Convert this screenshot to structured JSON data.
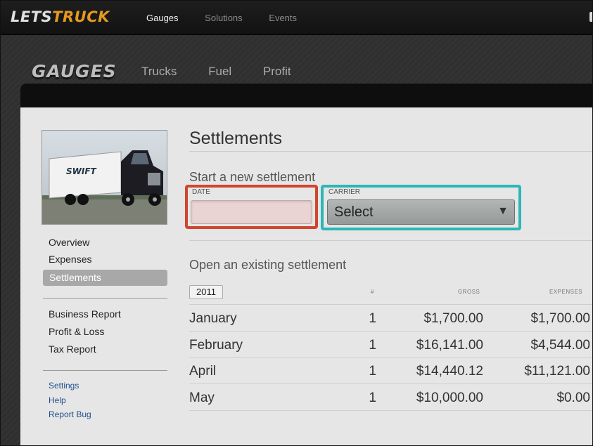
{
  "app": {
    "logo_part1": "LETS",
    "logo_part2": "TRUCK",
    "topnav": [
      "Gauges",
      "Solutions",
      "Events"
    ]
  },
  "section": {
    "title": "GAUGES",
    "subnav": [
      "Trucks",
      "Fuel",
      "Profit"
    ]
  },
  "sidebar": {
    "image_alt": "truck photo",
    "nav1": [
      "Overview",
      "Expenses",
      "Settlements"
    ],
    "active": "Settlements",
    "nav2": [
      "Business Report",
      "Profit & Loss",
      "Tax Report"
    ],
    "links": [
      "Settings",
      "Help",
      "Report Bug"
    ]
  },
  "main": {
    "title": "Settlements",
    "new_heading": "Start a new settlement",
    "date_label": "DATE",
    "date_value": "",
    "carrier_label": "CARRIER",
    "carrier_value": "Select",
    "open_heading": "Open an existing settlement",
    "year": "2011",
    "columns": {
      "num": "#",
      "gross": "GROSS",
      "expenses": "EXPENSES"
    },
    "rows": [
      {
        "month": "January",
        "num": "1",
        "gross": "$1,700.00",
        "expenses": "$1,700.00"
      },
      {
        "month": "February",
        "num": "1",
        "gross": "$16,141.00",
        "expenses": "$4,544.00"
      },
      {
        "month": "April",
        "num": "1",
        "gross": "$14,440.12",
        "expenses": "$11,121.00"
      },
      {
        "month": "May",
        "num": "1",
        "gross": "$10,000.00",
        "expenses": "$0.00"
      }
    ]
  },
  "colors": {
    "brand_accent": "#e39a1f",
    "highlight_red": "#d1452c",
    "highlight_teal": "#2cb7b6",
    "link": "#1f4f8c"
  }
}
